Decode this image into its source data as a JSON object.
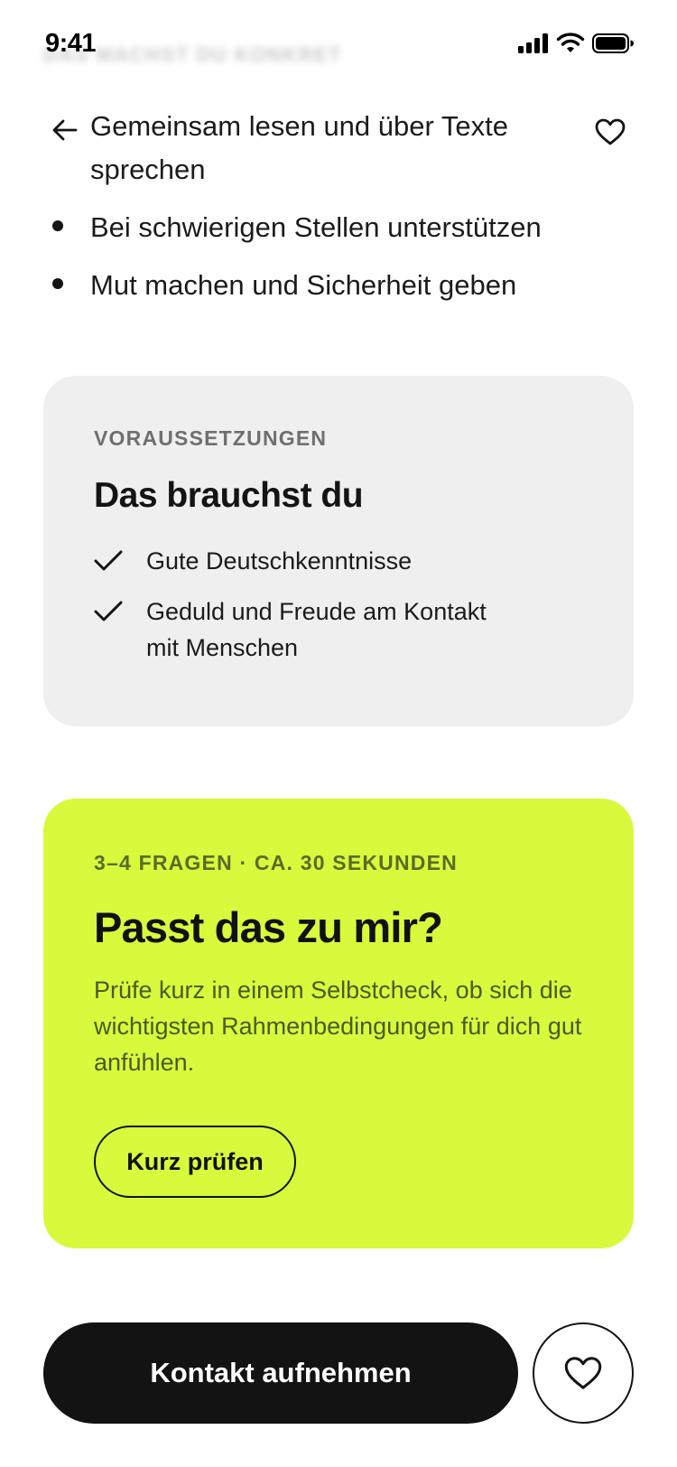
{
  "status_bar": {
    "time": "9:41",
    "faded_heading": "DAS MACHST DU KONKRET",
    "icons": [
      "cellular-signal-icon",
      "wifi-icon",
      "battery-icon"
    ]
  },
  "nav": {
    "back_icon": "arrow-left-icon",
    "favorite_icon": "heart-icon"
  },
  "tasks": {
    "items": [
      "Gemeinsam lesen und über Texte sprechen",
      "Bei schwierigen Stellen unterstützen",
      "Mut machen und Sicherheit geben"
    ]
  },
  "requirements": {
    "eyebrow": "VORAUSSETZUNGEN",
    "title": "Das brauchst du",
    "items": [
      "Gute Deutschkenntnisse",
      "Geduld und Freude am Kontakt mit Menschen"
    ],
    "item_icon": "checkmark-icon"
  },
  "self_check": {
    "eyebrow": "3–4 FRAGEN · CA. 30 SEKUNDEN",
    "title": "Passt das zu mir?",
    "description": "Prüfe kurz in einem Selbstcheck, ob sich die wichtigsten Rahmenbedingungen für dich gut anfühlen.",
    "button_label": "Kurz prüfen"
  },
  "actions": {
    "primary_label": "Kontakt aufnehmen",
    "favorite_icon": "heart-icon"
  },
  "colors": {
    "accent_lime": "#d7fa3c",
    "card_gray": "#efefef",
    "primary_dark": "#131313"
  }
}
